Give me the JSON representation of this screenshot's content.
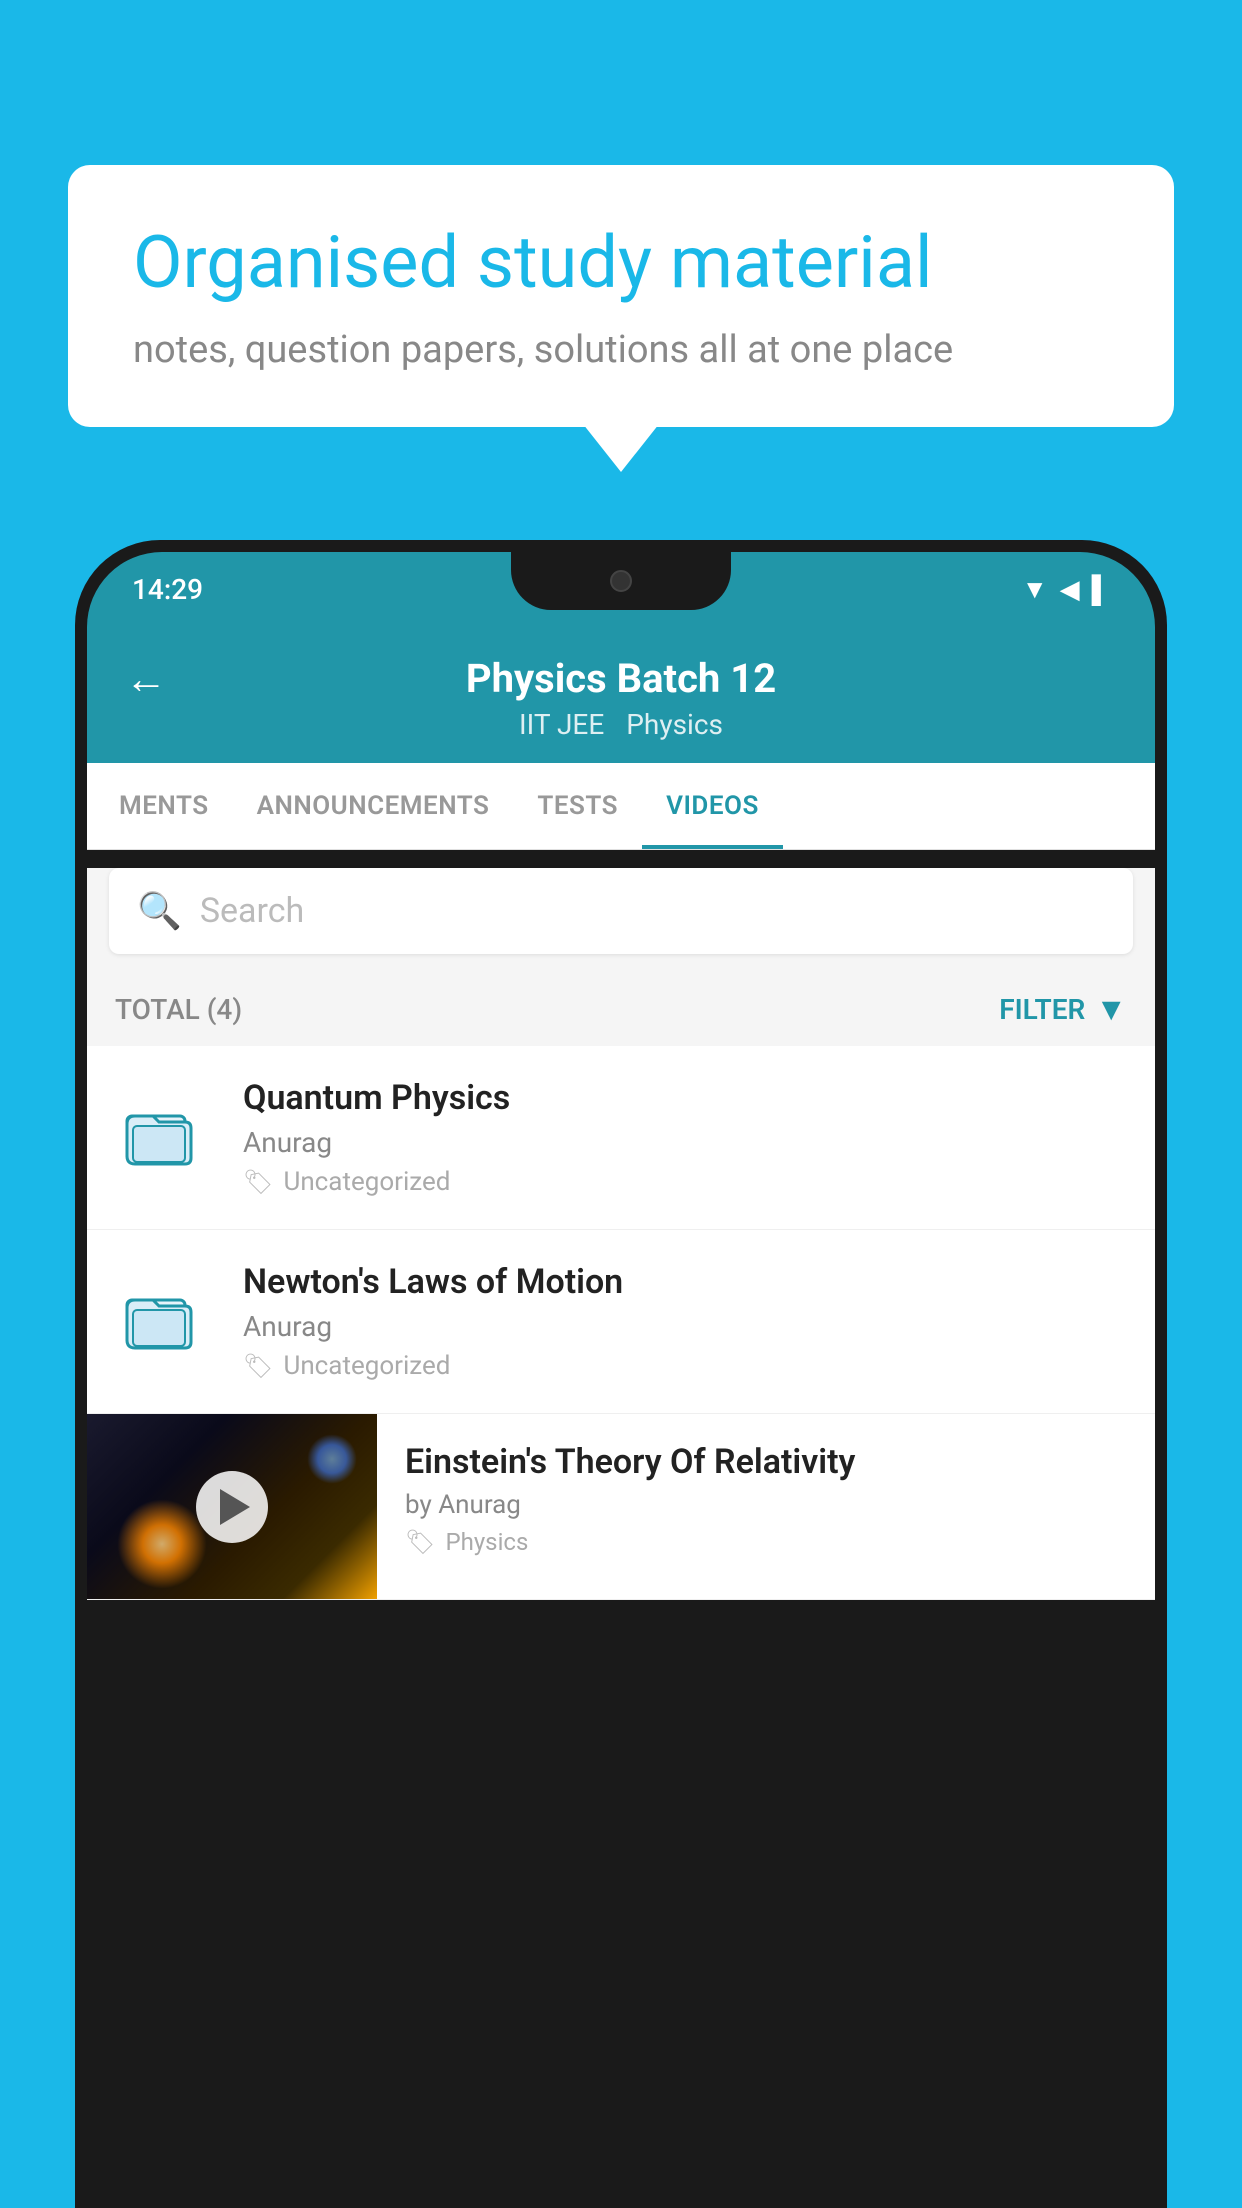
{
  "background_color": "#1ab8e8",
  "bubble": {
    "title": "Organised study material",
    "subtitle": "notes, question papers, solutions all at one place"
  },
  "status_bar": {
    "time": "14:29"
  },
  "header": {
    "back_label": "←",
    "title": "Physics Batch 12",
    "tag1": "IIT JEE",
    "tag2": "Physics"
  },
  "tabs": [
    {
      "label": "MENTS",
      "active": false
    },
    {
      "label": "ANNOUNCEMENTS",
      "active": false
    },
    {
      "label": "TESTS",
      "active": false
    },
    {
      "label": "VIDEOS",
      "active": true
    }
  ],
  "search": {
    "placeholder": "Search"
  },
  "filter_bar": {
    "total_label": "TOTAL (4)",
    "filter_label": "FILTER"
  },
  "videos": [
    {
      "title": "Quantum Physics",
      "author": "Anurag",
      "tag": "Uncategorized",
      "type": "folder"
    },
    {
      "title": "Newton's Laws of Motion",
      "author": "Anurag",
      "tag": "Uncategorized",
      "type": "folder"
    },
    {
      "title": "Einstein's Theory Of Relativity",
      "author": "by Anurag",
      "tag": "Physics",
      "type": "video"
    }
  ]
}
